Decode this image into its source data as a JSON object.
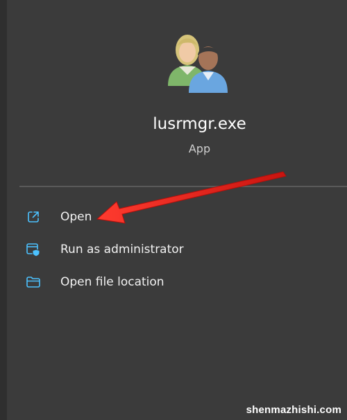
{
  "app": {
    "name": "lusrmgr.exe",
    "type": "App",
    "icon": "users-icon"
  },
  "menu": {
    "items": [
      {
        "label": "Open",
        "icon": "open-external-icon"
      },
      {
        "label": "Run as administrator",
        "icon": "shield-window-icon"
      },
      {
        "label": "Open file location",
        "icon": "folder-icon"
      }
    ]
  },
  "watermark": "shenmazhishi.com",
  "colors": {
    "background": "#3b3b3b",
    "icon_accent": "#4cc2ff",
    "arrow": "#e8201c"
  }
}
